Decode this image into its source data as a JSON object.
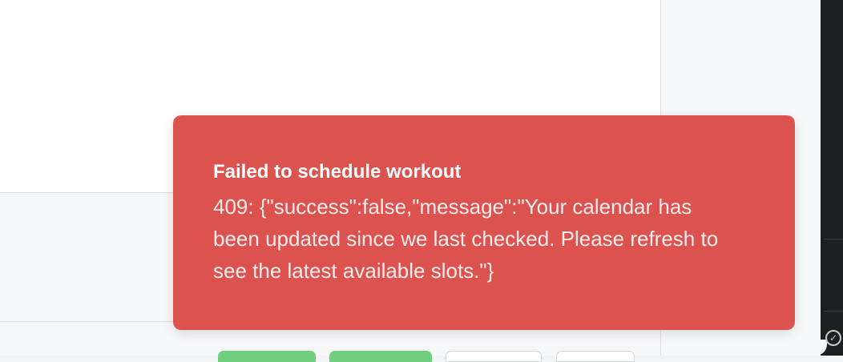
{
  "toast": {
    "title": "Failed to schedule workout",
    "message": "409: {\"success\":false,\"message\":\"Your calendar has been updated since we last checked. Please refresh to see the latest available slots.\"}",
    "type": "error",
    "background_color": "#dc524f"
  },
  "footer_buttons": {
    "colors": [
      "#6fcf7e",
      "#6fcf7e",
      "#ffffff",
      "#ffffff"
    ]
  },
  "status_icon": "check-circle-icon"
}
